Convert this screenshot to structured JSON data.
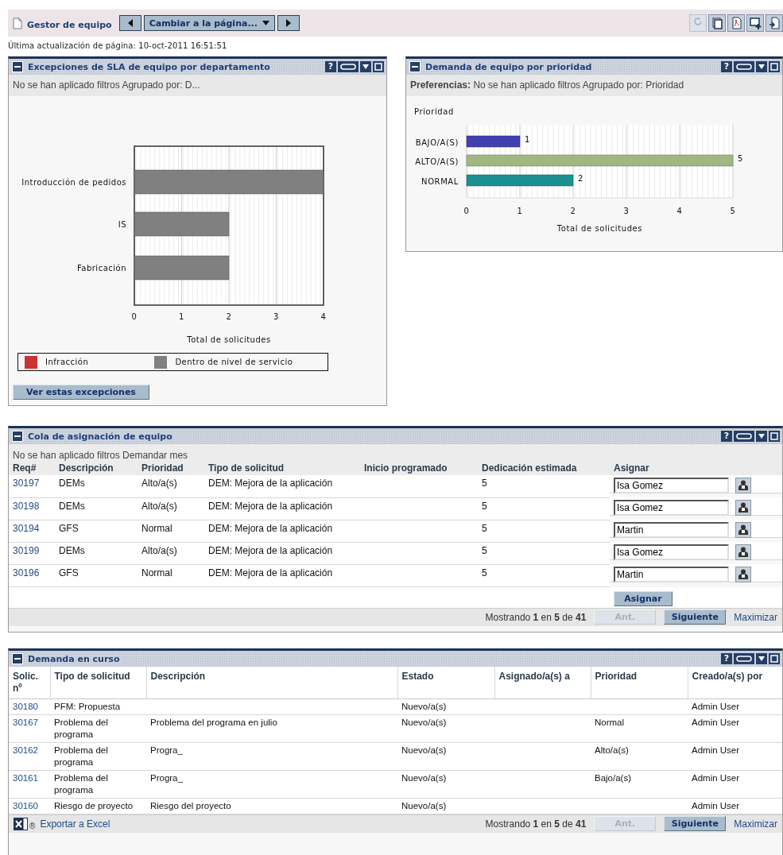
{
  "header": {
    "title": "Gestor de equipo",
    "page_menu": "Cambiar a la página...",
    "toolbar": [
      {
        "kind": "refresh",
        "disabled": true
      },
      {
        "kind": "copy",
        "disabled": false
      },
      {
        "kind": "pdf",
        "disabled": false
      },
      {
        "kind": "add",
        "disabled": false
      },
      {
        "kind": "export",
        "disabled": false
      }
    ]
  },
  "last_update": "Última actualización de página: 10-oct-2011 16:51:51",
  "sla_panel": {
    "title": "Excepciones de SLA de equipo por departamento",
    "help": "?",
    "filter": "No se han aplicado filtros Agrupado por: D...",
    "chart_data": {
      "type": "bar",
      "orientation": "horizontal",
      "stacked": true,
      "xlabel": "Total de solicitudes",
      "categories": [
        "Introducción de pedidos",
        "IS",
        "Fabricación"
      ],
      "series": [
        {
          "name": "Infracción",
          "color": "#cc3333",
          "values": [
            0,
            0,
            0
          ]
        },
        {
          "name": "Dentro de nivel de servicio",
          "color": "#808080",
          "values": [
            4,
            2,
            2
          ]
        }
      ],
      "xlim": [
        0,
        4
      ],
      "xticks": [
        0,
        1,
        2,
        3,
        4
      ],
      "grid": true
    },
    "button": "Ver estas excepciones"
  },
  "priority_panel": {
    "title": "Demanda de equipo por prioridad",
    "help": "?",
    "filter": "**Preferencias:** No se han aplicado filtros Agrupado por: Prioridad",
    "chart_data": {
      "type": "bar",
      "orientation": "horizontal",
      "legend_title": "Prioridad",
      "xlabel": "Total de solicitudes",
      "categories": [
        "BAJO/A(S)",
        "ALTO/A(S)",
        "NORMAL"
      ],
      "values": [
        1,
        5,
        2
      ],
      "colors": [
        "#4040b0",
        "#a0b880",
        "#1a9090"
      ],
      "data_labels": true,
      "xlim": [
        0,
        5
      ],
      "xticks": [
        0,
        1,
        2,
        3,
        4,
        5
      ],
      "grid": true
    }
  },
  "queue": {
    "title": "Cola de asignación de equipo",
    "help": "?",
    "filter": "No se han aplicado filtros Demandar mes",
    "columns": [
      "Req#",
      "Descripción",
      "Prioridad",
      "Tipo de solicitud",
      "Inicio programado",
      "Dedicación estimada",
      "Asignar"
    ],
    "rows": [
      {
        "id": "30197",
        "description": "DEMs",
        "priority": "Alto/a(s)",
        "type": "DEM: Mejora de la aplicación",
        "effort": "5",
        "assignee": "Isa Gomez"
      },
      {
        "id": "30198",
        "description": "DEMs",
        "priority": "Alto/a(s)",
        "type": "DEM: Mejora de la aplicación",
        "effort": "5",
        "assignee": "Isa Gomez"
      },
      {
        "id": "30194",
        "description": "GFS",
        "priority": "Normal",
        "type": "DEM: Mejora de la aplicación",
        "effort": "5",
        "assignee": "Martin"
      },
      {
        "id": "30199",
        "description": "DEMs",
        "priority": "Alto/a(s)",
        "type": "DEM: Mejora de la aplicación",
        "effort": "5",
        "assignee": "Isa Gomez"
      },
      {
        "id": "30196",
        "description": "GFS",
        "priority": "Normal",
        "type": "DEM: Mejora de la aplicación",
        "effort": "5",
        "assignee": "Martin"
      }
    ],
    "assign_button": "Asignar",
    "pager": {
      "text": "Mostrando **1** en **5** de **41**",
      "buttons": [
        {
          "label": "Ant.",
          "disabled": true
        },
        {
          "label": "Siguiente",
          "disabled": false
        }
      ],
      "link": "Maximizar"
    }
  },
  "demand": {
    "title": "Demanda en curso",
    "help": "?",
    "columns": [
      "Solic. nº",
      "Tipo de solicitud",
      "Descripción",
      "Estado",
      "Asignado/a(s) a",
      "Prioridad",
      "Creado/a(s) por"
    ],
    "rows": [
      {
        "id": "30180",
        "type": "PFM: Propuesta",
        "status": "Nuevo/a(s)",
        "created_by": "Admin User"
      },
      {
        "id": "30167",
        "type": "Problema del programa",
        "description": "Problema del programa en julio",
        "status": "Nuevo/a(s)",
        "priority": "Normal",
        "created_by": "Admin User"
      },
      {
        "id": "30162",
        "type": "Problema del programa",
        "description": "Progra_",
        "status": "Nuevo/a(s)",
        "priority": "Alto/a(s)",
        "created_by": "Admin User"
      },
      {
        "id": "30161",
        "type": "Problema del programa",
        "description": "Progra_",
        "status": "Nuevo/a(s)",
        "priority": "Bajo/a(s)",
        "created_by": "Admin User"
      },
      {
        "id": "30160",
        "type": "Riesgo de proyecto",
        "description": "Riesgo del proyecto",
        "status": "Nuevo/a(s)",
        "created_by": "Admin User"
      }
    ],
    "export_mark": "®",
    "export_link": "Exportar a Excel",
    "pager": {
      "text": "Mostrando **1** en **5** de **41**",
      "buttons": [
        {
          "label": "Ant.",
          "disabled": true
        },
        {
          "label": "Siguiente",
          "disabled": false
        }
      ],
      "link": "Maximizar"
    }
  }
}
